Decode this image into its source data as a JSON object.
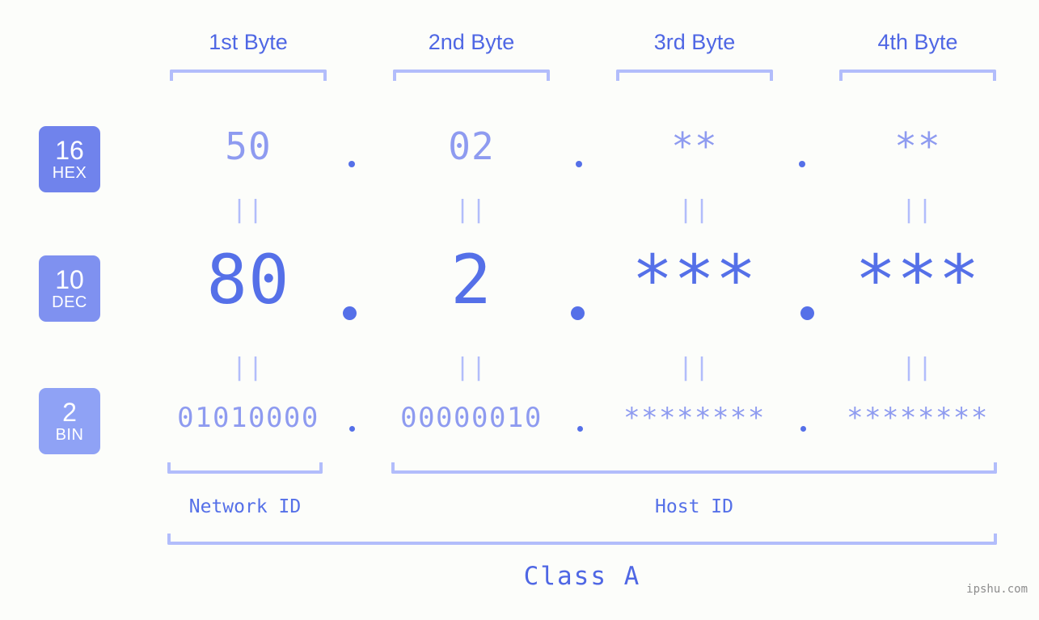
{
  "canvas": {
    "background": "#fcfdfa",
    "accent_strong": "#5570e8",
    "accent_mid": "#8e9bf0",
    "accent_light": "#b2bdfb",
    "badge_fill_dark": "#7083ec",
    "badge_fill_light": "#8fa2f5"
  },
  "byte_headers": [
    {
      "label": "1st Byte"
    },
    {
      "label": "2nd Byte"
    },
    {
      "label": "3rd Byte"
    },
    {
      "label": "4th Byte"
    }
  ],
  "rows": [
    {
      "badge": {
        "number": "16",
        "name": "HEX"
      },
      "values": [
        "50",
        "02",
        "**",
        "**"
      ],
      "separator": "."
    },
    {
      "badge": {
        "number": "10",
        "name": "DEC"
      },
      "values": [
        "80",
        "2",
        "***",
        "***"
      ],
      "separator": "."
    },
    {
      "badge": {
        "number": "2",
        "name": "BIN"
      },
      "values": [
        "01010000",
        "00000010",
        "********",
        "********"
      ],
      "separator": "."
    }
  ],
  "equality_glyph": "||",
  "footer": {
    "network_id_label": "Network ID",
    "host_id_label": "Host ID",
    "class_label": "Class A"
  },
  "watermark": "ipshu.com"
}
